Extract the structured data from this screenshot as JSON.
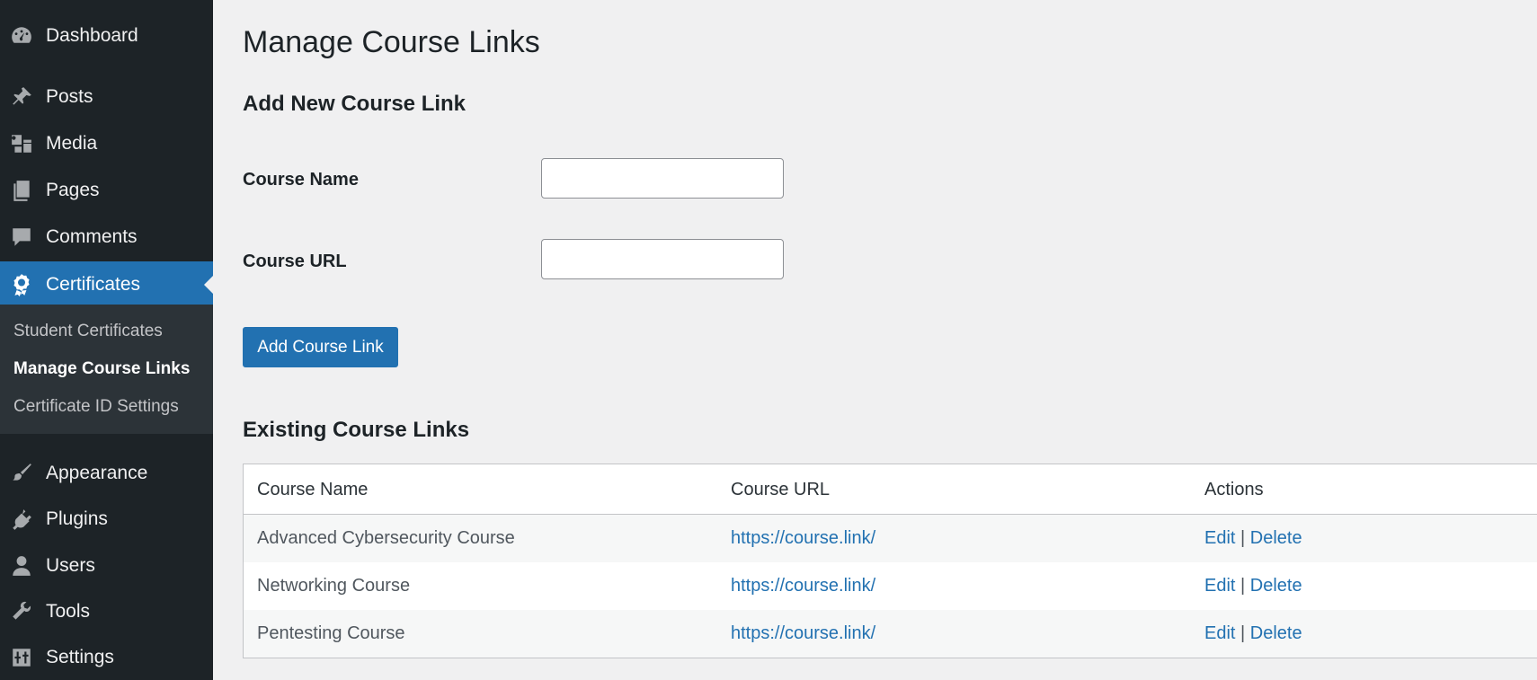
{
  "sidebar": {
    "items": [
      {
        "label": "Dashboard",
        "icon": "dashboard-icon"
      },
      {
        "label": "Posts",
        "icon": "pin-icon"
      },
      {
        "label": "Media",
        "icon": "media-icon"
      },
      {
        "label": "Pages",
        "icon": "pages-icon"
      },
      {
        "label": "Comments",
        "icon": "comment-icon"
      },
      {
        "label": "Certificates",
        "icon": "award-icon",
        "current": true
      },
      {
        "label": "Appearance",
        "icon": "brush-icon"
      },
      {
        "label": "Plugins",
        "icon": "plug-icon"
      },
      {
        "label": "Users",
        "icon": "user-icon"
      },
      {
        "label": "Tools",
        "icon": "wrench-icon"
      },
      {
        "label": "Settings",
        "icon": "settings-icon"
      }
    ],
    "submenu": [
      {
        "label": "Student Certificates"
      },
      {
        "label": "Manage Course Links",
        "current": true
      },
      {
        "label": "Certificate ID Settings"
      }
    ]
  },
  "main": {
    "title": "Manage Course Links",
    "add_heading": "Add New Course Link",
    "form": {
      "course_name_label": "Course Name",
      "course_name_value": "",
      "course_url_label": "Course URL",
      "course_url_value": "",
      "submit_label": "Add Course Link"
    },
    "existing_heading": "Existing Course Links",
    "table": {
      "headers": [
        "Course Name",
        "Course URL",
        "Actions"
      ],
      "rows": [
        {
          "name": "Advanced Cybersecurity Course",
          "url": "https://course.link/",
          "edit": "Edit",
          "sep": "|",
          "delete": "Delete"
        },
        {
          "name": "Networking Course",
          "url": "https://course.link/",
          "edit": "Edit",
          "sep": "|",
          "delete": "Delete"
        },
        {
          "name": "Pentesting Course",
          "url": "https://course.link/",
          "edit": "Edit",
          "sep": "|",
          "delete": "Delete"
        }
      ]
    }
  },
  "colors": {
    "sidebar_bg": "#1d2327",
    "accent": "#2271b1",
    "page_bg": "#f0f0f1"
  }
}
